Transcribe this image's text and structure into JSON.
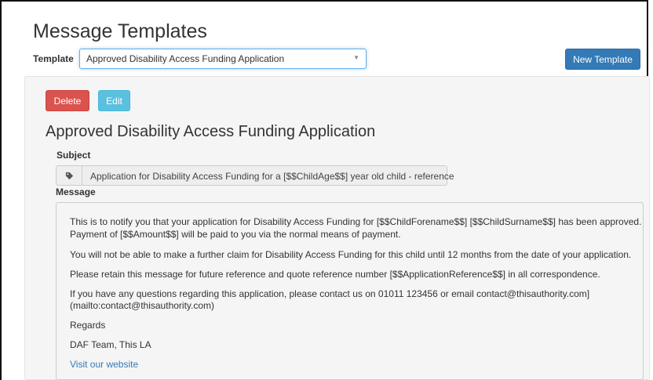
{
  "page": {
    "title": "Message Templates"
  },
  "template_picker": {
    "label": "Template",
    "selected": "Approved Disability Access Funding Application",
    "caret": "▼"
  },
  "toolbar": {
    "new_template": "New Template",
    "delete": "Delete",
    "edit": "Edit"
  },
  "template": {
    "heading": "Approved Disability Access Funding Application",
    "subject_label": "Subject",
    "subject_icon": "tag-icon",
    "subject": "Application for Disability Access Funding for a [$$ChildAge$$] year old child - reference",
    "message_label": "Message",
    "message": {
      "para1_line1": "This is to notify you that your application for Disability Access Funding for [$$ChildForename$$] [$$ChildSurname$$] has been approved.",
      "para1_line2": "Payment of [$$Amount$$] will be paid to you via the normal means of payment.",
      "para2": "You will not be able to make a further claim for Disability Access Funding for this child until 12 months from the date of your application.",
      "para3": "Please retain this message for future reference and quote reference number [$$ApplicationReference$$] in all correspondence.",
      "para4_line1": "If you have any questions regarding this application, please contact us on 01011 123456 or email contact@thisauthority.com]",
      "para4_line2": "(mailto:contact@thisauthority.com)",
      "regards": "Regards",
      "signoff": "DAF Team, This LA",
      "link": "Visit our website"
    }
  },
  "colors": {
    "primary": "#337ab7",
    "danger": "#d9534f",
    "info": "#5bc0de",
    "panel": "#f5f5f5"
  }
}
